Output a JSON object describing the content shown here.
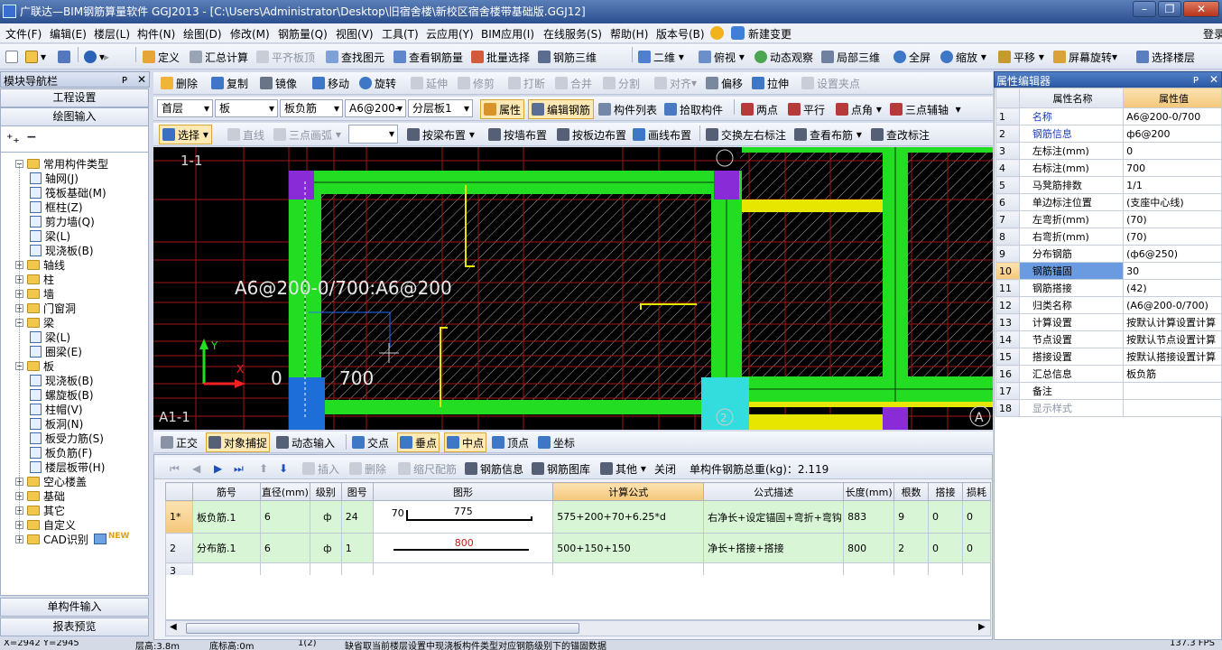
{
  "window": {
    "title": "广联达—BIM钢筋算量软件 GGJ2013 - [C:\\Users\\Administrator\\Desktop\\旧宿舍楼\\新校区宿舍楼带基础版.GGJ12]",
    "btn_min": "–",
    "btn_max": "❐",
    "btn_close": "✕"
  },
  "menu": [
    "文件(F)",
    "编辑(E)",
    "楼层(L)",
    "构件(N)",
    "绘图(D)",
    "修改(M)",
    "钢筋量(Q)",
    "视图(V)",
    "工具(T)",
    "云应用(Y)",
    "BIM应用(I)",
    "在线服务(S)",
    "帮助(H)",
    "版本号(B)",
    "新建变更",
    "登录"
  ],
  "toolbar1": {
    "define": "定义",
    "sum": "汇总计算",
    "flat_top": "平齐板顶",
    "find": "查找图元",
    "view_rebar": "查看钢筋量",
    "batch": "批量选择",
    "rebar3d": "钢筋三维",
    "view2d": "二维",
    "top_view": "俯视",
    "dyn": "动态观察",
    "local3d": "局部三维",
    "full": "全屏",
    "zoom": "缩放",
    "pan": "平移",
    "rotate_screen": "屏幕旋转",
    "select_floor": "选择楼层"
  },
  "toolbar2": {
    "delete": "删除",
    "copy": "复制",
    "mirror": "镜像",
    "move": "移动",
    "rotate": "旋转",
    "extend": "延伸",
    "trim": "修剪",
    "break": "打断",
    "merge": "合并",
    "split": "分割",
    "align": "对齐",
    "offset": "偏移",
    "stretch": "拉伸",
    "grip": "设置夹点"
  },
  "toolbar3": {
    "floor": "首层",
    "type": "板",
    "subtype": "板负筋",
    "name": "A6@200-",
    "layer": "分层板1",
    "props": "属性",
    "edit_rebar": "编辑钢筋",
    "list": "构件列表",
    "pick": "拾取构件",
    "point2": "两点",
    "parallel": "平行",
    "angle": "点角",
    "axis3": "三点辅轴"
  },
  "toolbar4": {
    "select": "选择",
    "line": "直线",
    "arc": "三点画弧",
    "by_beam": "按梁布置",
    "by_wall": "按墙布置",
    "by_edge": "按板边布置",
    "draw_line": "画线布置",
    "swap": "交换左右标注",
    "view_layout": "查看布筋",
    "edit_mark": "查改标注"
  },
  "nav": {
    "title": "模块导航栏",
    "pin": "ᴘ",
    "close": "✕",
    "btn_project": "工程设置",
    "btn_draw": "绘图输入",
    "btn_single": "单构件输入",
    "btn_report": "报表预览",
    "tree": [
      {
        "label": "常用构件类型",
        "level": 0,
        "kind": "folder",
        "open": true
      },
      {
        "label": "轴网(J)",
        "level": 1,
        "kind": "item"
      },
      {
        "label": "筏板基础(M)",
        "level": 1,
        "kind": "item"
      },
      {
        "label": "框柱(Z)",
        "level": 1,
        "kind": "item"
      },
      {
        "label": "剪力墙(Q)",
        "level": 1,
        "kind": "item"
      },
      {
        "label": "梁(L)",
        "level": 1,
        "kind": "item"
      },
      {
        "label": "现浇板(B)",
        "level": 1,
        "kind": "item"
      },
      {
        "label": "轴线",
        "level": 0,
        "kind": "folder",
        "open": false
      },
      {
        "label": "柱",
        "level": 0,
        "kind": "folder",
        "open": false
      },
      {
        "label": "墙",
        "level": 0,
        "kind": "folder",
        "open": false
      },
      {
        "label": "门窗洞",
        "level": 0,
        "kind": "folder",
        "open": false
      },
      {
        "label": "梁",
        "level": 0,
        "kind": "folder",
        "open": true
      },
      {
        "label": "梁(L)",
        "level": 1,
        "kind": "item"
      },
      {
        "label": "圈梁(E)",
        "level": 1,
        "kind": "item"
      },
      {
        "label": "板",
        "level": 0,
        "kind": "folder",
        "open": true
      },
      {
        "label": "现浇板(B)",
        "level": 1,
        "kind": "item"
      },
      {
        "label": "螺旋板(B)",
        "level": 1,
        "kind": "item"
      },
      {
        "label": "柱帽(V)",
        "level": 1,
        "kind": "item"
      },
      {
        "label": "板洞(N)",
        "level": 1,
        "kind": "item"
      },
      {
        "label": "板受力筋(S)",
        "level": 1,
        "kind": "item"
      },
      {
        "label": "板负筋(F)",
        "level": 1,
        "kind": "item"
      },
      {
        "label": "楼层板带(H)",
        "level": 1,
        "kind": "item"
      },
      {
        "label": "空心楼盖",
        "level": 0,
        "kind": "folder",
        "open": false
      },
      {
        "label": "基础",
        "level": 0,
        "kind": "folder",
        "open": false
      },
      {
        "label": "其它",
        "level": 0,
        "kind": "folder",
        "open": false
      },
      {
        "label": "自定义",
        "level": 0,
        "kind": "folder",
        "open": false
      },
      {
        "label": "CAD识别",
        "level": 0,
        "kind": "folder",
        "open": false
      }
    ],
    "new_badge": "NEW"
  },
  "canvas": {
    "mark_tl": "1-1",
    "mark_bl": "A1-1",
    "rebar_label": "A6@200-0/700:A6@200",
    "dim_left": "0",
    "dim_right": "700",
    "axis_x": "X",
    "axis_y": "Y",
    "axis_a": "A",
    "axis_2": "2"
  },
  "snapbar": {
    "ortho": "正交",
    "snap": "对象捕捉",
    "dyn_input": "动态输入",
    "cross": "交点",
    "perp": "垂点",
    "mid": "中点",
    "vertex": "顶点",
    "coord": "坐标"
  },
  "gridbar": {
    "insert": "插入",
    "delete": "删除",
    "reduce": "缩尺配筋",
    "info": "钢筋信息",
    "library": "钢筋图库",
    "other": "其他",
    "close": "关闭",
    "total": "单构件钢筋总重(kg)：2.119"
  },
  "rebar_table": {
    "headers": [
      "",
      "筋号",
      "直径(mm)",
      "级别",
      "图号",
      "图形",
      "计算公式",
      "公式描述",
      "长度(mm)",
      "根数",
      "搭接",
      "损耗"
    ],
    "rows": [
      {
        "no": "1*",
        "name": "板负筋.1",
        "dia": "6",
        "grade": "ф",
        "fig": "24",
        "shape_left": "70",
        "shape_mid": "775",
        "formula": "575+200+70+6.25*d",
        "desc": "右净长+设定锚固+弯折+弯钩",
        "len": "883",
        "count": "9",
        "lap": "0",
        "loss": "0"
      },
      {
        "no": "2",
        "name": "分布筋.1",
        "dia": "6",
        "grade": "ф",
        "fig": "1",
        "shape_left": "",
        "shape_mid": "800",
        "formula": "500+150+150",
        "desc": "净长+搭接+搭接",
        "len": "800",
        "count": "2",
        "lap": "0",
        "loss": "0"
      },
      {
        "no": "3",
        "name": "",
        "dia": "",
        "grade": "",
        "fig": "",
        "shape_left": "",
        "shape_mid": "",
        "formula": "",
        "desc": "",
        "len": "",
        "count": "",
        "lap": "",
        "loss": ""
      }
    ]
  },
  "props": {
    "title": "属性编辑器",
    "col_name": "属性名称",
    "col_value": "属性值",
    "rows": [
      {
        "no": "1",
        "name": "名称",
        "value": "A6@200-0/700",
        "blue": true
      },
      {
        "no": "2",
        "name": "钢筋信息",
        "value": "ф6@200",
        "blue": true
      },
      {
        "no": "3",
        "name": "左标注(mm)",
        "value": "0",
        "blue": false
      },
      {
        "no": "4",
        "name": "右标注(mm)",
        "value": "700",
        "blue": false
      },
      {
        "no": "5",
        "name": "马凳筋排数",
        "value": "1/1",
        "blue": false
      },
      {
        "no": "6",
        "name": "单边标注位置",
        "value": "(支座中心线)",
        "blue": false
      },
      {
        "no": "7",
        "name": "左弯折(mm)",
        "value": "(70)",
        "blue": false
      },
      {
        "no": "8",
        "name": "右弯折(mm)",
        "value": "(70)",
        "blue": false
      },
      {
        "no": "9",
        "name": "分布钢筋",
        "value": "(ф6@250)",
        "blue": false
      },
      {
        "no": "10",
        "name": "钢筋锚固",
        "value": "30",
        "blue": false,
        "selected": true
      },
      {
        "no": "11",
        "name": "钢筋搭接",
        "value": "(42)",
        "blue": false
      },
      {
        "no": "12",
        "name": "归类名称",
        "value": "(A6@200-0/700)",
        "blue": false
      },
      {
        "no": "13",
        "name": "计算设置",
        "value": "按默认计算设置计算",
        "blue": false
      },
      {
        "no": "14",
        "name": "节点设置",
        "value": "按默认节点设置计算",
        "blue": false
      },
      {
        "no": "15",
        "name": "搭接设置",
        "value": "按默认搭接设置计算",
        "blue": false
      },
      {
        "no": "16",
        "name": "汇总信息",
        "value": "板负筋",
        "blue": false
      },
      {
        "no": "17",
        "name": "备注",
        "value": "",
        "blue": false
      },
      {
        "no": "18",
        "name": "显示样式",
        "value": "",
        "blue": false,
        "gray": true
      }
    ]
  },
  "status": {
    "coords": "X=2942 Y=2945",
    "floor_h": "层高:3.8m",
    "base_h": "底标高:0m",
    "count": "1(2)",
    "message": "缺省取当前楼层设置中现浇板构件类型对应钢筋级别下的锚固数据",
    "fps": "137.3 FPS"
  }
}
